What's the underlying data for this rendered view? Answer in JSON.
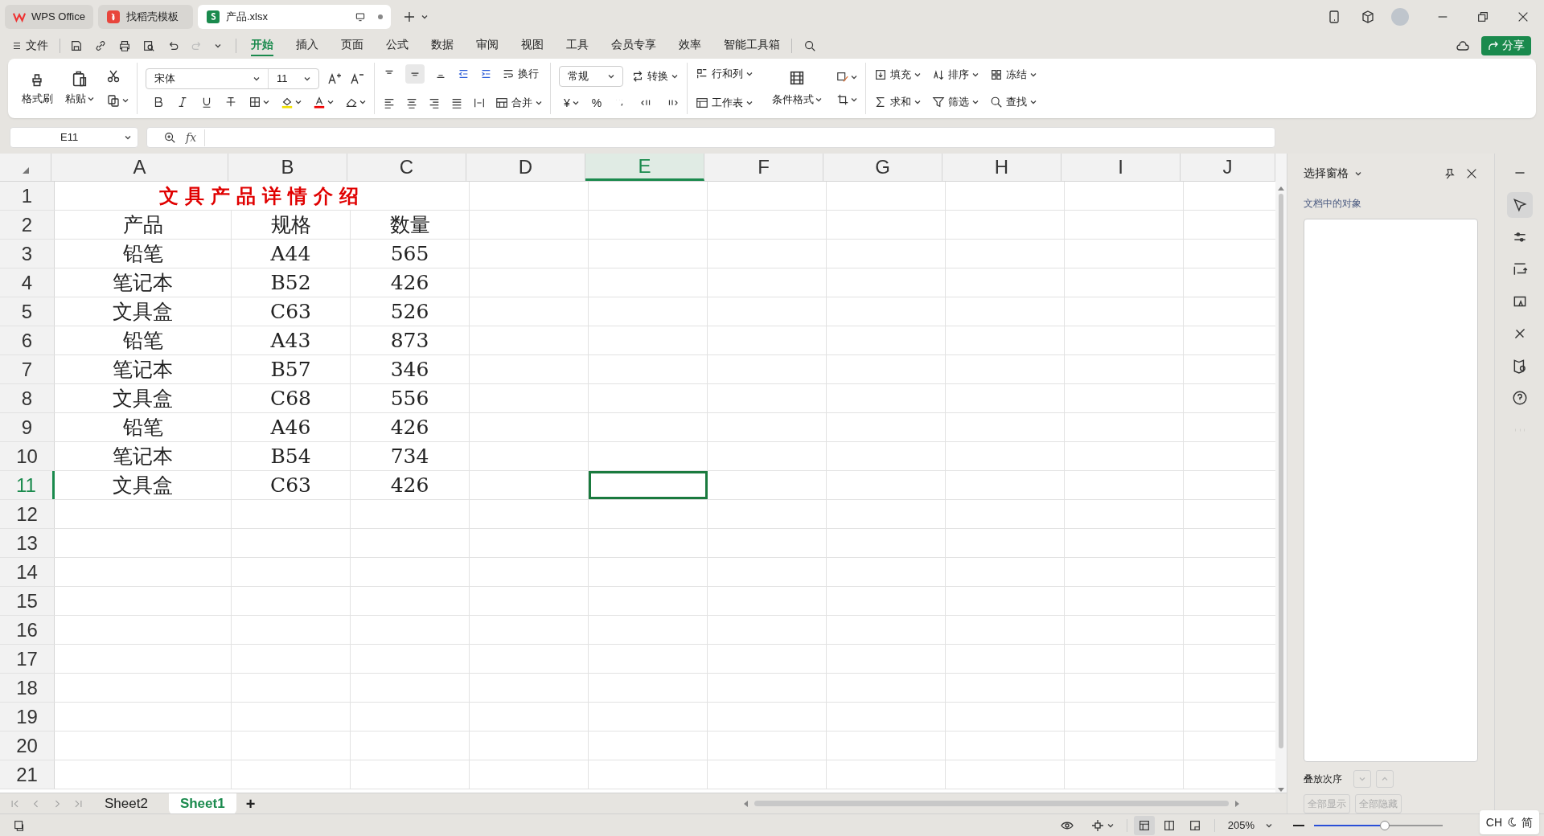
{
  "title_bar": {
    "tabs": [
      {
        "label": "WPS Office",
        "kind": "home",
        "selected": false
      },
      {
        "label": "找稻壳模板",
        "kind": "template",
        "selected": false
      },
      {
        "label": "产品.xlsx",
        "kind": "sheet",
        "selected": true
      }
    ]
  },
  "menu": {
    "file": "文件",
    "tabs": [
      {
        "label": "开始",
        "selected": true
      },
      {
        "label": "插入",
        "selected": false
      },
      {
        "label": "页面",
        "selected": false
      },
      {
        "label": "公式",
        "selected": false
      },
      {
        "label": "数据",
        "selected": false
      },
      {
        "label": "审阅",
        "selected": false
      },
      {
        "label": "视图",
        "selected": false
      },
      {
        "label": "工具",
        "selected": false
      },
      {
        "label": "会员专享",
        "selected": false
      },
      {
        "label": "效率",
        "selected": false
      },
      {
        "label": "智能工具箱",
        "selected": false
      }
    ],
    "share": "分享"
  },
  "ribbon": {
    "format_painter": "格式刷",
    "paste": "粘贴",
    "font": "宋体",
    "font_size": "11",
    "wrap": "换行",
    "merge": "合并",
    "number_format": "常规",
    "convert": "转换",
    "currency": "¥",
    "percent": "%",
    "rows_cols": "行和列",
    "worksheet": "工作表",
    "conditional_format": "条件格式",
    "tools": [
      {
        "label": "填充",
        "kind": "fill"
      },
      {
        "label": "排序",
        "kind": "sort"
      },
      {
        "label": "冻结",
        "kind": "freeze"
      },
      {
        "label": "求和",
        "kind": "sum"
      },
      {
        "label": "筛选",
        "kind": "filter"
      },
      {
        "label": "查找",
        "kind": "find"
      }
    ]
  },
  "formula_bar": {
    "name_box": "E11",
    "fx": "fx"
  },
  "sheet": {
    "columns": [
      {
        "label": "A",
        "selected": false
      },
      {
        "label": "B",
        "selected": false
      },
      {
        "label": "C",
        "selected": false
      },
      {
        "label": "D",
        "selected": false
      },
      {
        "label": "E",
        "selected": true
      },
      {
        "label": "F",
        "selected": false
      },
      {
        "label": "G",
        "selected": false
      },
      {
        "label": "H",
        "selected": false
      },
      {
        "label": "I",
        "selected": false
      },
      {
        "label": "J",
        "selected": false
      }
    ],
    "rows": [
      {
        "label": "1",
        "selected": false,
        "title": "文具产品详情介绍"
      },
      {
        "label": "2",
        "selected": false,
        "cells": [
          "产品",
          "规格",
          "数量"
        ]
      },
      {
        "label": "3",
        "selected": false,
        "cells": [
          "铅笔",
          "A44",
          "565"
        ]
      },
      {
        "label": "4",
        "selected": false,
        "cells": [
          "笔记本",
          "B52",
          "426"
        ]
      },
      {
        "label": "5",
        "selected": false,
        "cells": [
          "文具盒",
          "C63",
          "526"
        ]
      },
      {
        "label": "6",
        "selected": false,
        "cells": [
          "铅笔",
          "A43",
          "873"
        ]
      },
      {
        "label": "7",
        "selected": false,
        "cells": [
          "笔记本",
          "B57",
          "346"
        ]
      },
      {
        "label": "8",
        "selected": false,
        "cells": [
          "文具盒",
          "C68",
          "556"
        ]
      },
      {
        "label": "9",
        "selected": false,
        "cells": [
          "铅笔",
          "A46",
          "426"
        ]
      },
      {
        "label": "10",
        "selected": false,
        "cells": [
          "笔记本",
          "B54",
          "734"
        ]
      },
      {
        "label": "11",
        "selected": true,
        "cells": [
          "文具盒",
          "C63",
          "426"
        ]
      },
      {
        "label": "12",
        "selected": false
      },
      {
        "label": "13",
        "selected": false
      },
      {
        "label": "14",
        "selected": false
      },
      {
        "label": "15",
        "selected": false
      },
      {
        "label": "16",
        "selected": false
      },
      {
        "label": "17",
        "selected": false
      },
      {
        "label": "18",
        "selected": false
      },
      {
        "label": "19",
        "selected": false
      },
      {
        "label": "20",
        "selected": false
      },
      {
        "label": "21",
        "selected": false
      }
    ]
  },
  "sheet_tabs": [
    {
      "label": "Sheet2",
      "selected": false
    },
    {
      "label": "Sheet1",
      "selected": true
    }
  ],
  "add_sheet": "+",
  "selection_pane": {
    "title": "选择窗格",
    "subtitle": "文档中的对象",
    "order_label": "叠放次序",
    "buttons": [
      {
        "label": "全部显示",
        "disabled": true
      },
      {
        "label": "全部隐藏",
        "disabled": true
      }
    ]
  },
  "status_bar": {
    "zoom": "205%",
    "zoom_slider": {
      "level": 0.55
    },
    "ime": [
      "CH",
      "简"
    ]
  }
}
